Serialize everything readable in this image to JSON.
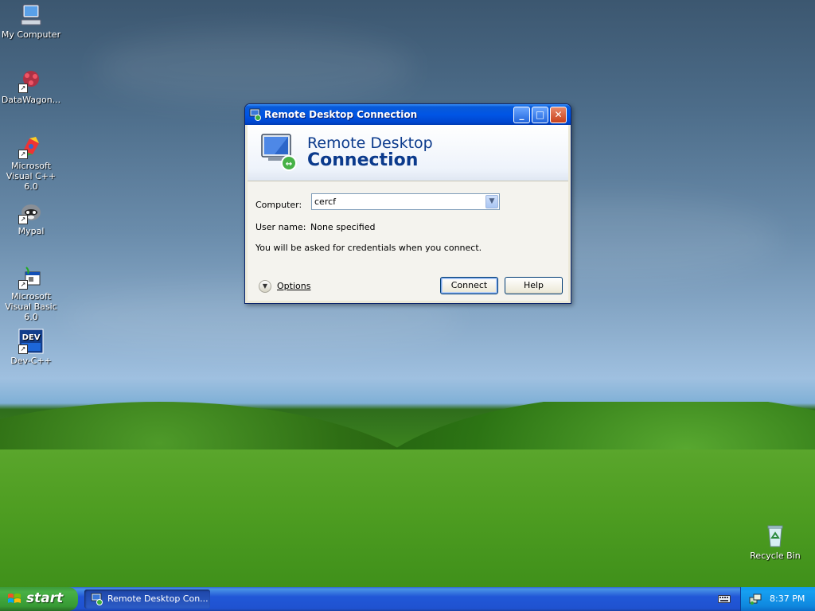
{
  "desktop": {
    "icons": [
      {
        "label": "My Computer",
        "icon": "my-computer-icon"
      },
      {
        "label": "DataWagon...",
        "icon": "datawagon-icon"
      },
      {
        "label": "Microsoft Visual C++ 6.0",
        "icon": "visual-cpp-icon"
      },
      {
        "label": "Mypal",
        "icon": "mypal-icon"
      },
      {
        "label": "Microsoft Visual Basic 6.0",
        "icon": "visual-basic-icon"
      },
      {
        "label": "Dev-C++",
        "icon": "dev-cpp-icon"
      },
      {
        "label": "Recycle Bin",
        "icon": "recycle-bin-icon"
      }
    ]
  },
  "window": {
    "title": "Remote Desktop Connection",
    "banner_line1": "Remote Desktop",
    "banner_line2": "Connection",
    "computer_label": "Computer:",
    "computer_value": "cercf",
    "username_label": "User name:",
    "username_value": "None specified",
    "info_text": "You will be asked for credentials when you connect.",
    "options_label": "Options",
    "connect_label": "Connect",
    "help_label": "Help"
  },
  "taskbar": {
    "start_label": "start",
    "task_label": "Remote Desktop Con...",
    "clock": "8:37 PM"
  },
  "colors": {
    "titlebar": "#0055e5",
    "taskbar": "#2157d7",
    "start": "#49b046",
    "banner_text": "#0b3a8c"
  }
}
